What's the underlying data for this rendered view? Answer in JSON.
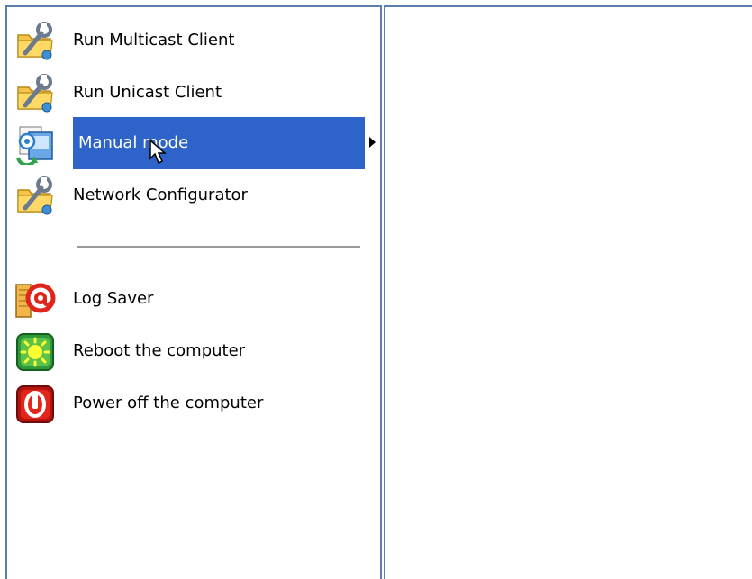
{
  "menu": {
    "items": [
      {
        "label": "Run Multicast Client",
        "icon": "wrench-folder-icon"
      },
      {
        "label": "Run Unicast Client",
        "icon": "wrench-folder-icon"
      },
      {
        "label": "Manual mode",
        "icon": "manual-mode-icon",
        "selected": true,
        "has_submenu": true
      },
      {
        "label": "Network Configurator",
        "icon": "wrench-folder-icon"
      },
      {
        "label": "Log Saver",
        "icon": "log-saver-icon"
      },
      {
        "label": "Reboot the computer",
        "icon": "reboot-icon"
      },
      {
        "label": "Power off the computer",
        "icon": "power-off-icon"
      }
    ]
  },
  "colors": {
    "selection": "#2e63c9",
    "border": "#5d7fae",
    "separator": "#9a9a9a"
  }
}
